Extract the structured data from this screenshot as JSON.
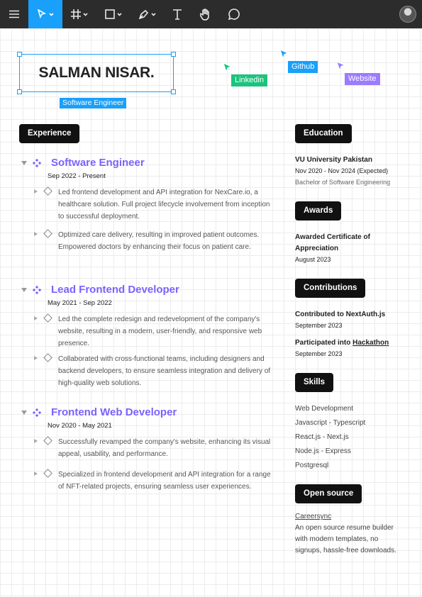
{
  "toolbar": {
    "tools": [
      "menu",
      "move",
      "frame",
      "shape",
      "pen",
      "text",
      "hand",
      "comment"
    ]
  },
  "header": {
    "name": "SALMAN NISAR.",
    "role": "Software Engineer"
  },
  "cursors": [
    {
      "label": "Linkedin",
      "color": "#1bc47d"
    },
    {
      "label": "Github",
      "color": "#18a0fb"
    },
    {
      "label": "Website",
      "color": "#9b7bff"
    }
  ],
  "experience": {
    "heading": "Experience",
    "jobs": [
      {
        "title": "Software Engineer",
        "date": "Sep 2022 - Present",
        "bullets": [
          "Led frontend development and API integration for NexCare.io, a healthcare solution. Full project lifecycle involvement from inception to successful deployment.",
          "Optimized care delivery, resulting in improved patient outcomes. Empowered doctors by enhancing their focus on patient care."
        ]
      },
      {
        "title": "Lead Frontend Developer",
        "date": "May 2021 - Sep 2022",
        "bullets": [
          "Led the complete redesign and redevelopment of the company's website, resulting in a modern, user-friendly, and responsive web presence.",
          "Collaborated with cross-functional teams, including designers and backend developers, to ensure seamless integration and delivery of high-quality web solutions."
        ]
      },
      {
        "title": "Frontend Web Developer",
        "date": "Nov 2020 - May 2021",
        "bullets": [
          "Successfully revamped the company's website, enhancing its visual appeal, usability, and performance.",
          "Specialized in frontend development and API integration for a range of NFT-related projects, ensuring seamless user experiences."
        ]
      }
    ]
  },
  "education": {
    "heading": "Education",
    "school": "VU University Pakistan",
    "dates": "Nov 2020 - Nov 2024 (Expected)",
    "degree": "Bachelor of Software Engineering"
  },
  "awards": {
    "heading": "Awards",
    "line1": "Awarded Certificate of",
    "line2": "Appreciation",
    "date": "August 2023"
  },
  "contributions": {
    "heading": "Contributions",
    "items": [
      {
        "title": "Contributed to NextAuth.js",
        "date": "September 2023"
      },
      {
        "title_prefix": "Participated into ",
        "title_link": "Hackathon",
        "date": "September 2023"
      }
    ]
  },
  "skills": {
    "heading": "Skills",
    "items": [
      "Web Development",
      "Javascript - Typescript",
      "React.js - Next.js",
      "Node.js - Express",
      "Postgresql"
    ]
  },
  "open_source": {
    "heading": "Open source",
    "project": "Careersync",
    "line1": "An open source resume builder",
    "line2": "with modern templates, no",
    "line3": "signups, hassle-free downloads."
  },
  "colors": {
    "accent": "#18a0fb",
    "job_title": "#7b61ff",
    "toolbar_bg": "#2c2c2c"
  }
}
